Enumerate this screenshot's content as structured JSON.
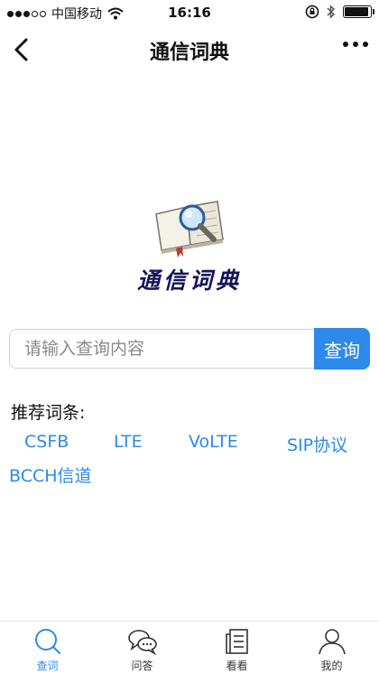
{
  "status_bar": {
    "carrier": "中国移动",
    "time": "16:16"
  },
  "nav": {
    "title": "通信词典"
  },
  "logo": {
    "text": "通信词典"
  },
  "search": {
    "placeholder": "请输入查询内容",
    "value": "",
    "button_label": "查询"
  },
  "recommend": {
    "title": "推荐词条:",
    "items": [
      "CSFB",
      "LTE",
      "VoLTE",
      "SIP协议",
      "BCCH信道"
    ]
  },
  "tabs": [
    {
      "label": "查词",
      "icon": "search-icon",
      "active": true
    },
    {
      "label": "问答",
      "icon": "chat-bubbles-icon",
      "active": false
    },
    {
      "label": "看看",
      "icon": "news-icon",
      "active": false
    },
    {
      "label": "我的",
      "icon": "person-icon",
      "active": false
    }
  ],
  "colors": {
    "accent": "#2d89ea",
    "logo_text": "#14145a",
    "tab_inactive": "#333333"
  }
}
